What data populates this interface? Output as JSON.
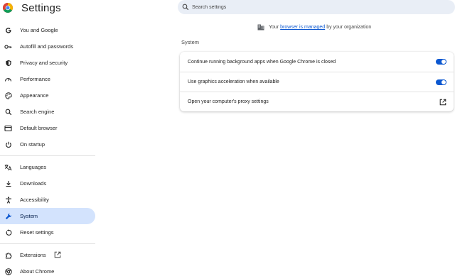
{
  "header": {
    "title": "Settings",
    "logo_icon": "chrome-logo-icon",
    "search_placeholder": "Search settings"
  },
  "sidebar": {
    "group1": [
      {
        "label": "You and Google",
        "icon": "google-g-icon"
      },
      {
        "label": "Autofill and passwords",
        "icon": "key-icon"
      },
      {
        "label": "Privacy and security",
        "icon": "shield-icon"
      },
      {
        "label": "Performance",
        "icon": "speedometer-icon"
      },
      {
        "label": "Appearance",
        "icon": "palette-icon"
      },
      {
        "label": "Search engine",
        "icon": "search-icon"
      },
      {
        "label": "Default browser",
        "icon": "browser-window-icon"
      },
      {
        "label": "On startup",
        "icon": "power-icon"
      }
    ],
    "group2": [
      {
        "label": "Languages",
        "icon": "translate-icon"
      },
      {
        "label": "Downloads",
        "icon": "download-icon"
      },
      {
        "label": "Accessibility",
        "icon": "accessibility-icon"
      },
      {
        "label": "System",
        "icon": "wrench-icon",
        "active": true
      },
      {
        "label": "Reset settings",
        "icon": "reset-icon"
      }
    ],
    "group3": [
      {
        "label": "Extensions",
        "icon": "puzzle-icon"
      },
      {
        "label": "About Chrome",
        "icon": "chrome-outline-icon"
      }
    ]
  },
  "managed_notice": {
    "prefix": "Your",
    "link": "browser is managed",
    "suffix": "by your organization"
  },
  "section": {
    "title": "System",
    "rows": [
      {
        "label": "Continue running background apps when Google Chrome is closed",
        "toggle_on": true
      },
      {
        "label": "Use graphics acceleration when available",
        "toggle_on": true
      },
      {
        "label": "Open your computer's proxy settings",
        "control": "open-in-new-icon"
      }
    ]
  },
  "colors": {
    "accent": "#0b57d0",
    "active_nav_bg": "#d3e3fd",
    "search_bg": "#e9eef6"
  }
}
